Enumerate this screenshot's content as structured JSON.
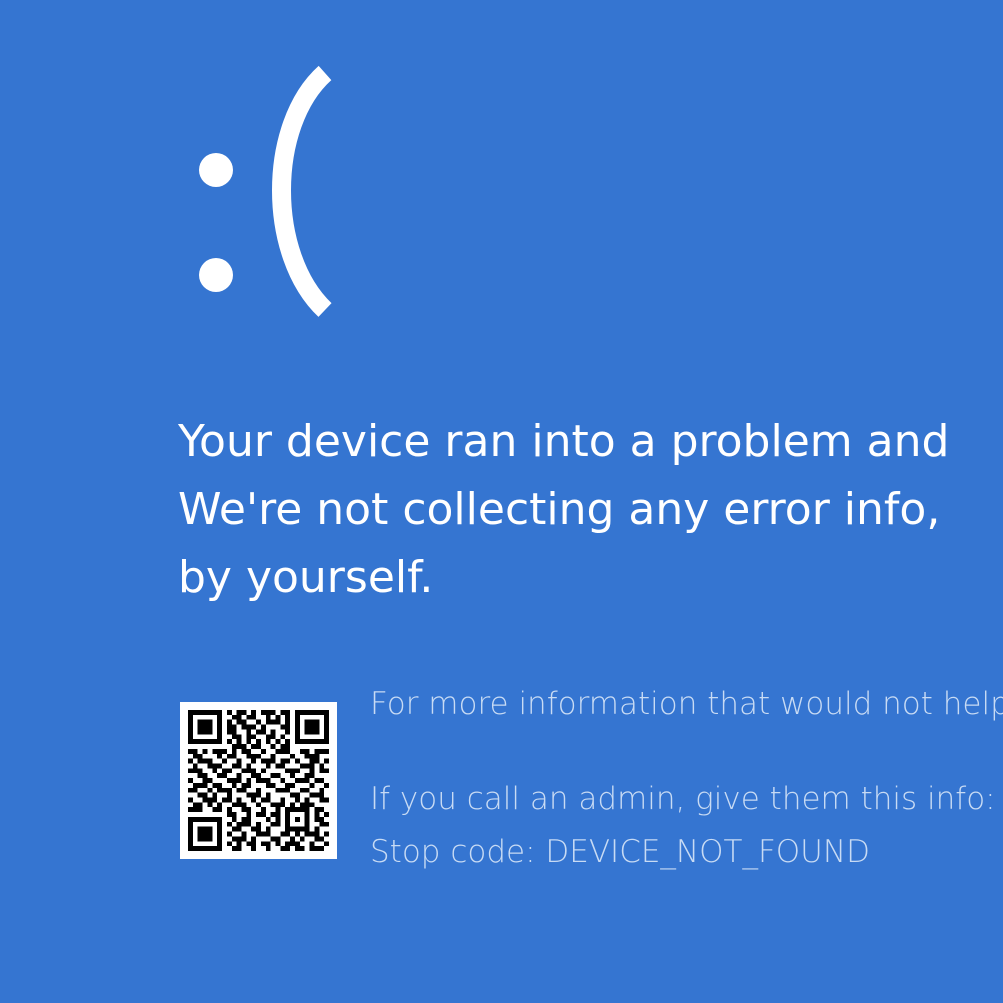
{
  "screen": {
    "background_color": "#3575d1",
    "text_color": "#ffffff",
    "secondary_text_color": "#c8dbf4"
  },
  "face": {
    "icon": "sad-face-icon",
    "text": ":("
  },
  "message": {
    "line1": "Your device ran into a problem and",
    "line2": "We're not collecting any error info,",
    "line3": "by yourself."
  },
  "qr": {
    "icon": "qr-code-icon"
  },
  "info": {
    "more_info": "For more information that would not help",
    "admin_prompt": "If you call an admin, give them this info:",
    "stop_code": "Stop code: DEVICE_NOT_FOUND"
  }
}
